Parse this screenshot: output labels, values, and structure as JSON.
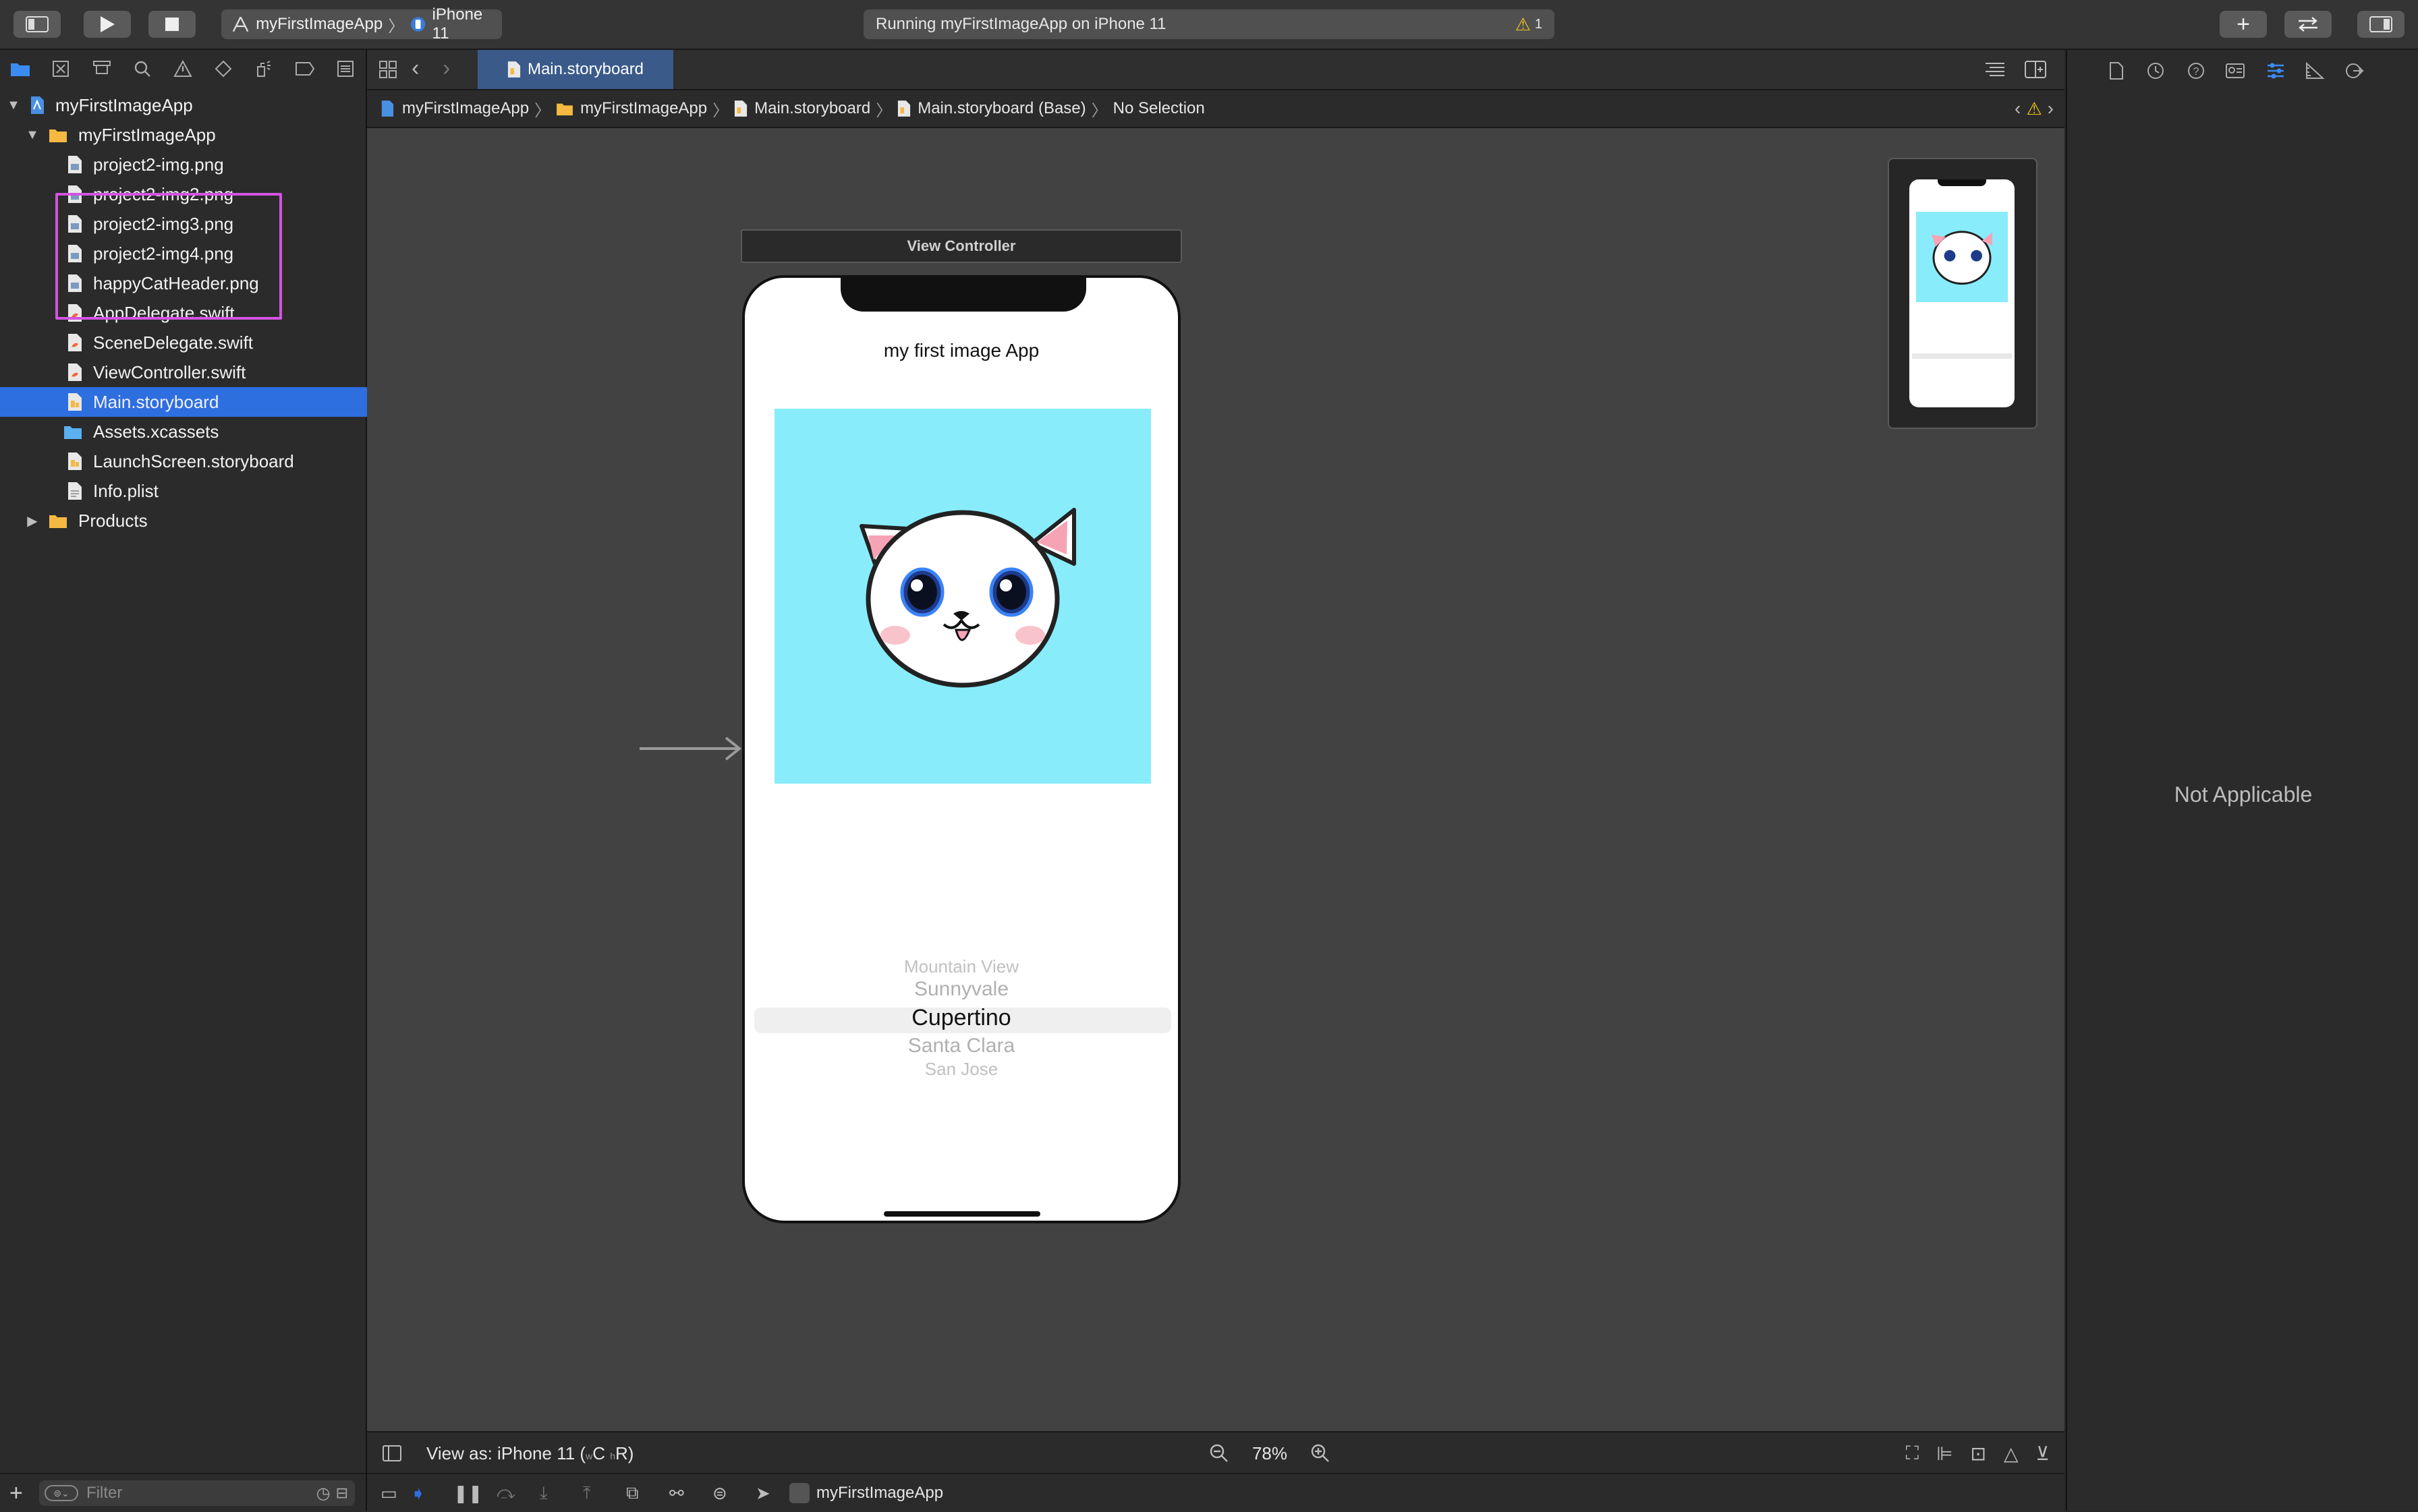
{
  "toolbar": {
    "scheme_target": "myFirstImageApp",
    "scheme_device": "iPhone 11",
    "status_text": "Running myFirstImageApp on iPhone 11",
    "warning_count": "1"
  },
  "navigator": {
    "items": [
      {
        "label": "myFirstImageApp",
        "kind": "project"
      },
      {
        "label": "myFirstImageApp",
        "kind": "group"
      },
      {
        "label": "project2-img.png",
        "kind": "image"
      },
      {
        "label": "project2-img2.png",
        "kind": "image"
      },
      {
        "label": "project2-img3.png",
        "kind": "image"
      },
      {
        "label": "project2-img4.png",
        "kind": "image"
      },
      {
        "label": "happyCatHeader.png",
        "kind": "image"
      },
      {
        "label": "AppDelegate.swift",
        "kind": "swift"
      },
      {
        "label": "SceneDelegate.swift",
        "kind": "swift"
      },
      {
        "label": "ViewController.swift",
        "kind": "swift"
      },
      {
        "label": "Main.storyboard",
        "kind": "storyboard"
      },
      {
        "label": "Assets.xcassets",
        "kind": "assets"
      },
      {
        "label": "LaunchScreen.storyboard",
        "kind": "storyboard"
      },
      {
        "label": "Info.plist",
        "kind": "plist"
      },
      {
        "label": "Products",
        "kind": "group"
      }
    ],
    "filter_placeholder": "Filter"
  },
  "editor": {
    "tab_label": "Main.storyboard",
    "breadcrumbs": [
      "myFirstImageApp",
      "myFirstImageApp",
      "Main.storyboard",
      "Main.storyboard (Base)",
      "No Selection"
    ],
    "scene_title": "View Controller",
    "app_label": "my first image App",
    "picker_items": [
      "Mountain View",
      "Sunnyvale",
      "Cupertino",
      "Santa Clara",
      "San Jose"
    ],
    "view_as": "View as: iPhone 11 (",
    "view_as_w": "w",
    "view_as_c": "C",
    "view_as_h": "h",
    "view_as_r": "R)",
    "zoom": "78%"
  },
  "debug": {
    "target_label": "myFirstImageApp"
  },
  "inspector": {
    "empty_text": "Not Applicable"
  },
  "colors": {
    "accent": "#2e6fe0",
    "highlight": "#d154e0",
    "image_bg": "#88ecfb",
    "warning": "#f5c518"
  }
}
